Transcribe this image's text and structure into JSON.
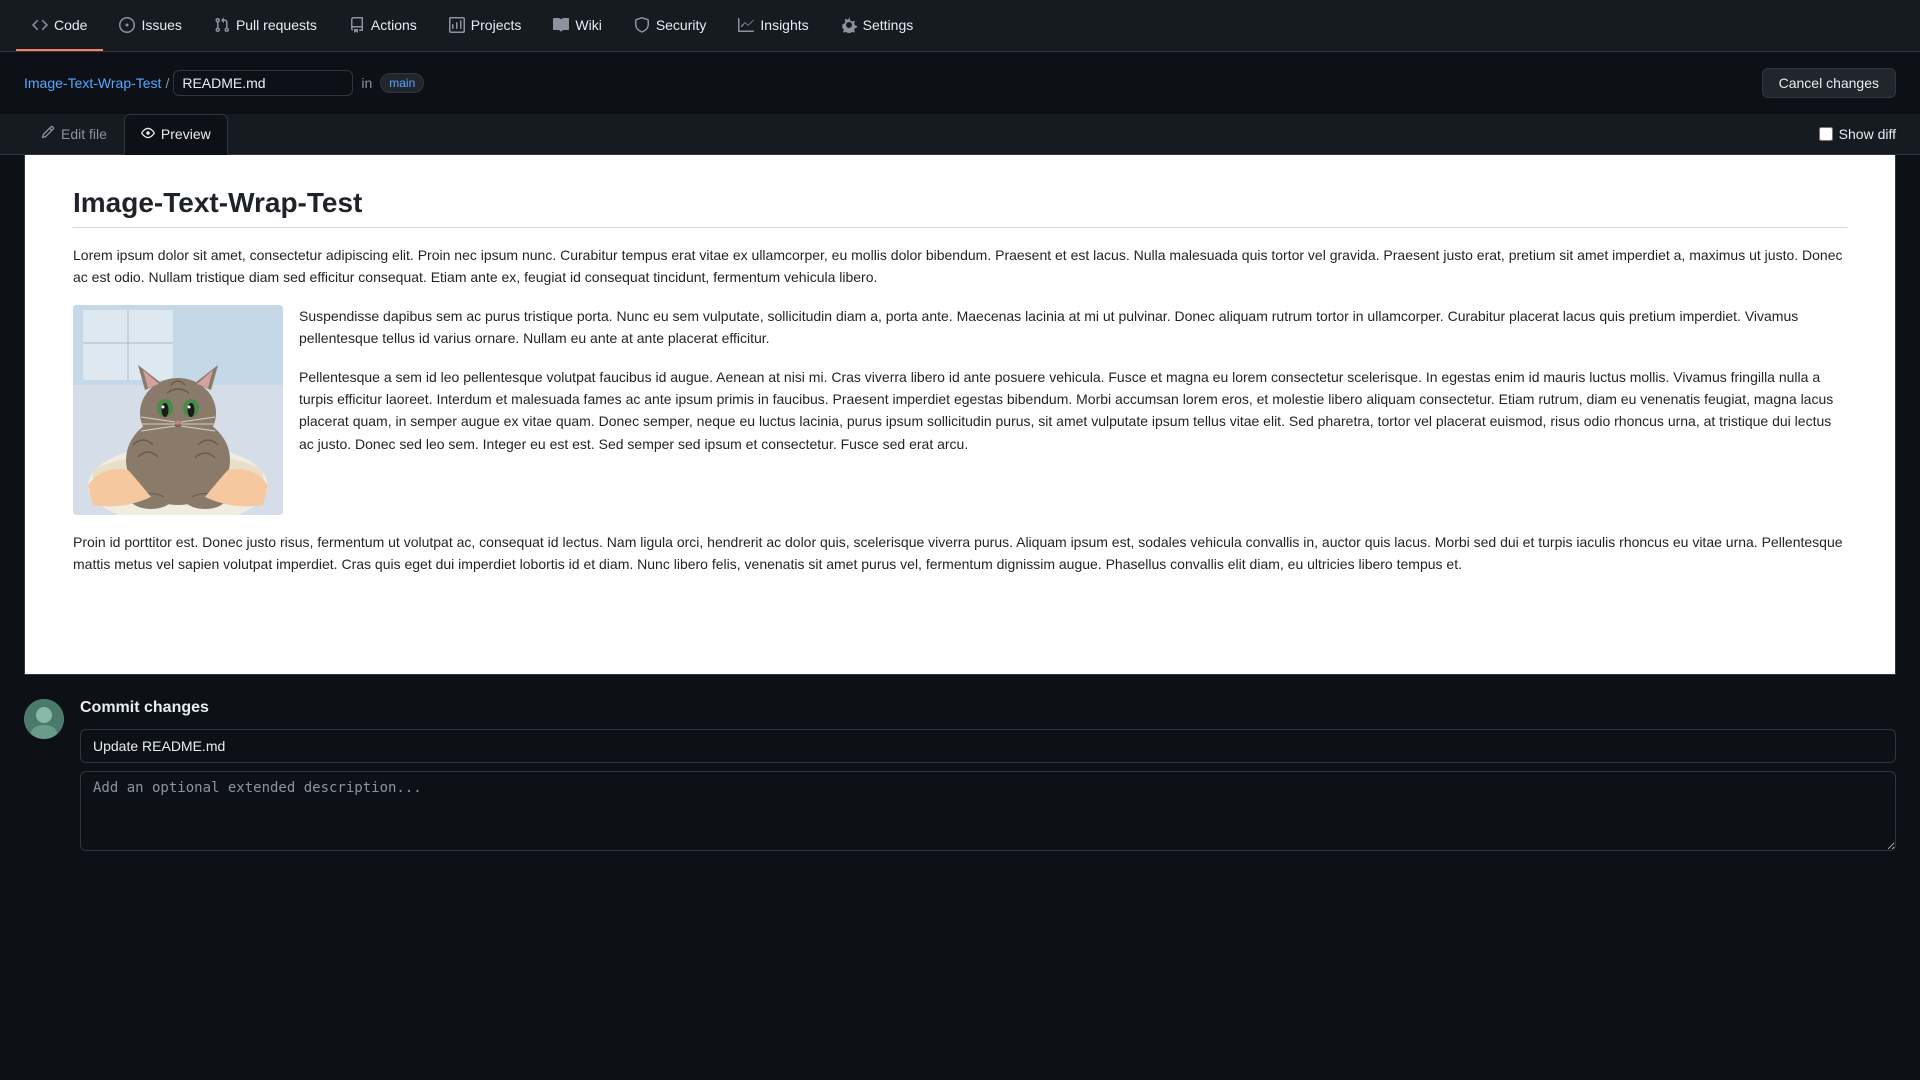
{
  "nav": {
    "tabs": [
      {
        "id": "code",
        "label": "Code",
        "active": true,
        "icon": "code"
      },
      {
        "id": "issues",
        "label": "Issues",
        "active": false,
        "icon": "issue"
      },
      {
        "id": "pull-requests",
        "label": "Pull requests",
        "active": false,
        "icon": "pr"
      },
      {
        "id": "actions",
        "label": "Actions",
        "active": false,
        "icon": "actions"
      },
      {
        "id": "projects",
        "label": "Projects",
        "active": false,
        "icon": "projects"
      },
      {
        "id": "wiki",
        "label": "Wiki",
        "active": false,
        "icon": "wiki"
      },
      {
        "id": "security",
        "label": "Security",
        "active": false,
        "icon": "shield"
      },
      {
        "id": "insights",
        "label": "Insights",
        "active": false,
        "icon": "graph"
      },
      {
        "id": "settings",
        "label": "Settings",
        "active": false,
        "icon": "gear"
      }
    ]
  },
  "editor_header": {
    "repo_link": "Image-Text-Wrap-Test",
    "sep": "/",
    "filename": "README.md",
    "in_label": "in",
    "branch": "main",
    "cancel_label": "Cancel changes"
  },
  "editor_tabs": {
    "edit_label": "Edit file",
    "preview_label": "Preview",
    "active_tab": "preview",
    "show_diff_label": "Show diff"
  },
  "preview": {
    "title": "Image-Text-Wrap-Test",
    "paragraph1": "Lorem ipsum dolor sit amet, consectetur adipiscing elit. Proin nec ipsum nunc. Curabitur tempus erat vitae ex ullamcorper, eu mollis dolor bibendum. Praesent et est lacus. Nulla malesuada quis tortor vel gravida. Praesent justo erat, pretium sit amet imperdiet a, maximus ut justo. Donec ac est odio. Nullam tristique diam sed efficitur consequat. Etiam ante ex, feugiat id consequat tincidunt, fermentum vehicula libero.",
    "paragraph_beside_image": "Suspendisse dapibus sem ac purus tristique porta. Nunc eu sem vulputate, sollicitudin diam a, porta ante. Maecenas lacinia at mi ut pulvinar. Donec aliquam rutrum tortor in ullamcorper. Curabitur placerat lacus quis pretium imperdiet. Vivamus pellentesque tellus id varius ornare. Nullam eu ante at ante placerat efficitur.",
    "paragraph_below_image_1": "Pellentesque a sem id leo pellentesque volutpat faucibus id augue. Aenean at nisi mi. Cras viverra libero id ante posuere vehicula. Fusce et magna eu lorem consectetur scelerisque. In egestas enim id mauris luctus mollis. Vivamus fringilla nulla a turpis efficitur laoreet. Interdum et malesuada fames ac ante ipsum primis in faucibus. Praesent imperdiet egestas bibendum. Morbi accumsan lorem eros, et molestie libero aliquam consectetur. Etiam rutrum, diam eu venenatis feugiat, magna lacus placerat quam, in semper augue ex vitae quam. Donec semper, neque eu luctus lacinia, purus ipsum sollicitudin purus, sit amet vulputate ipsum tellus vitae elit. Sed pharetra, tortor vel placerat euismod, risus odio rhoncus urna, at tristique dui lectus ac justo. Donec sed leo sem. Integer eu est est. Sed semper sed ipsum et consectetur. Fusce sed erat arcu.",
    "paragraph3": "Proin id porttitor est. Donec justo risus, fermentum ut volutpat ac, consequat id lectus. Nam ligula orci, hendrerit ac dolor quis, scelerisque viverra purus. Aliquam ipsum est, sodales vehicula convallis in, auctor quis lacus. Morbi sed dui et turpis iaculis rhoncus eu vitae urna. Pellentesque mattis metus vel sapien volutpat imperdiet. Cras quis eget dui imperdiet lobortis id et diam. Nunc libero felis, venenatis sit amet purus vel, fermentum dignissim augue. Phasellus convallis elit diam, eu ultricies libero tempus et."
  },
  "commit": {
    "title": "Commit changes",
    "input_value": "Update README.md",
    "input_placeholder": "Update README.md",
    "textarea_placeholder": "Add an optional extended description..."
  }
}
